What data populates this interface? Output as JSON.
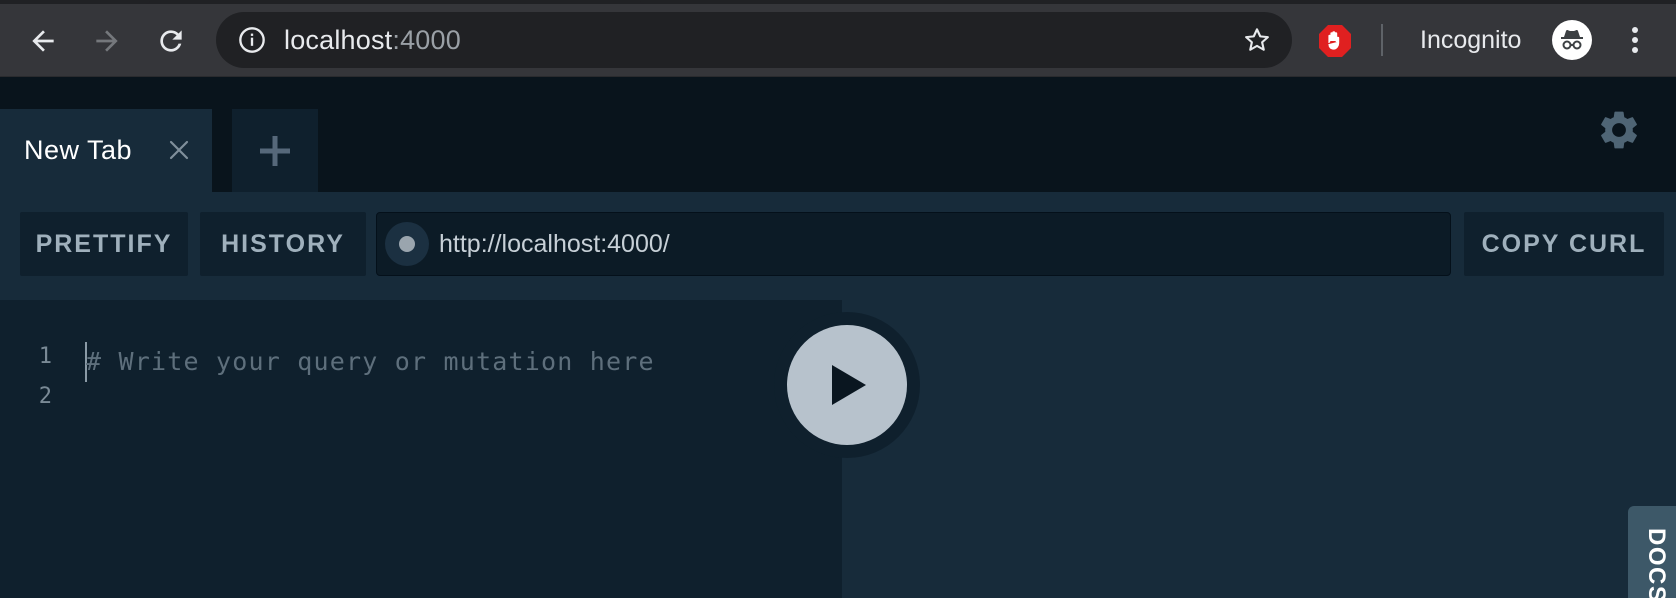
{
  "browser": {
    "url_host": "localhost",
    "url_port": ":4000",
    "incognito_label": "Incognito",
    "icons": {
      "back": "arrow-left-icon",
      "forward": "arrow-right-icon",
      "reload": "reload-icon",
      "info": "info-icon",
      "bookmark": "star-icon",
      "extension": "adblock-stop-icon",
      "incognito": "incognito-icon",
      "menu": "kebab-menu-icon"
    }
  },
  "playground": {
    "tabs": [
      {
        "label": "New Tab",
        "active": true
      }
    ],
    "toolbar": {
      "prettify_label": "PRETTIFY",
      "history_label": "HISTORY",
      "endpoint_url": "http://localhost:4000/",
      "copy_curl_label": "COPY CURL"
    },
    "editor": {
      "line_numbers": [
        "1",
        "2"
      ],
      "placeholder": "# Write your query or mutation here"
    },
    "docs_label": "DOCS",
    "colors": {
      "tabbar_bg": "#09141c",
      "panel_bg": "#172b3a",
      "editor_bg": "#0f202d",
      "run_button": "#b7c2cc"
    }
  }
}
